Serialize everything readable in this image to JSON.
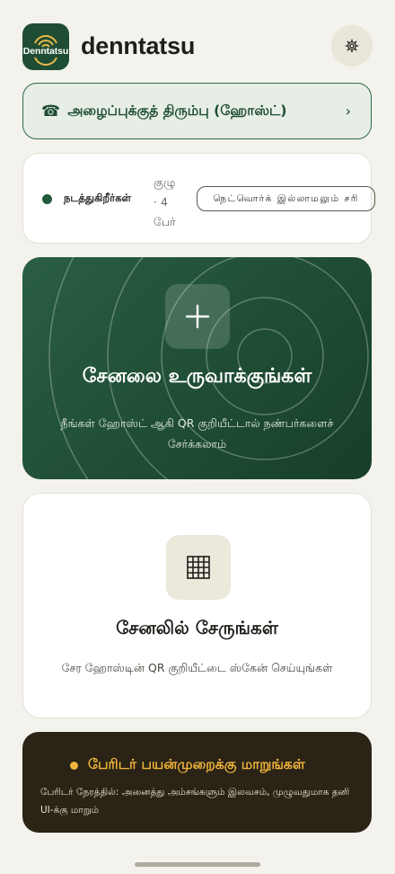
{
  "header": {
    "logo_text": "Denntatsu",
    "app_title": "denntatsu",
    "settings_icon": "gear-icon"
  },
  "callback": {
    "icon": "phone-icon",
    "label": "அழைப்புக்குத் திரும்பு (ஹோஸ்ட்)",
    "chevron": "›"
  },
  "status": {
    "label": "நடத்துகிறீர்கள்",
    "count_line1": "குழு",
    "count_line2": "· 4",
    "count_line3": "பேர்",
    "badge": "நெட்வொர்க் இல்லாமலும் சரி"
  },
  "create": {
    "title": "சேனலை உருவாக்குங்கள்",
    "subtitle": "நீங்கள் ஹோஸ்ட் ஆகி QR குறியீட்டால் நண்பர்களைச் சேர்க்கலாம்"
  },
  "join": {
    "title": "சேனலில் சேருங்கள்",
    "subtitle": "சேர ஹோஸ்டின் QR குறியீட்டை ஸ்கேன் செய்யுங்கள்"
  },
  "elder": {
    "title": "பேரிடர் பயன்முறைக்கு மாறுங்கள்",
    "subtitle": "பேரிடர் நேரத்தில்: அனைத்து அம்சங்களும் இலவசம், முழுவதுமாக தனி UI-க்கு மாறும்"
  },
  "colors": {
    "brand_green": "#1f4d33",
    "accent_amber": "#f0b43a",
    "background": "#f4f2ec"
  }
}
